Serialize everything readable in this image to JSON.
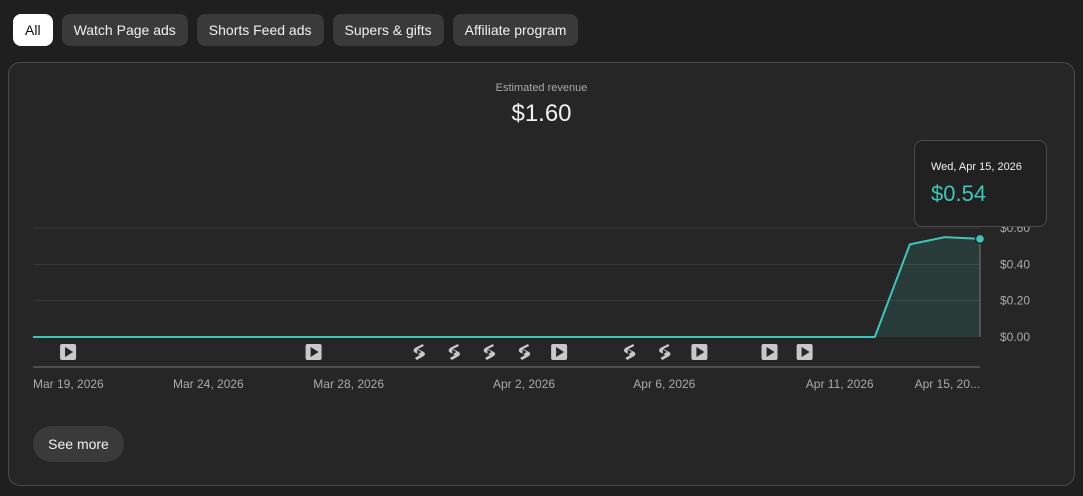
{
  "filters": [
    {
      "label": "All",
      "active": true
    },
    {
      "label": "Watch Page ads",
      "active": false
    },
    {
      "label": "Shorts Feed ads",
      "active": false
    },
    {
      "label": "Supers & gifts",
      "active": false
    },
    {
      "label": "Affiliate program",
      "active": false
    }
  ],
  "metric": {
    "label": "Estimated revenue",
    "value": "$1.60"
  },
  "tooltip": {
    "date": "Wed, Apr 15, 2026",
    "value": "$0.54"
  },
  "see_more_label": "See more",
  "colors": {
    "accent": "#3ec6b9",
    "background": "#1f1f1f",
    "card": "#262626"
  },
  "chart_data": {
    "type": "area",
    "title": "",
    "xlabel": "",
    "ylabel": "",
    "ylim": [
      0,
      0.6
    ],
    "y_ticks": [
      {
        "value": 0,
        "label": "$0.00"
      },
      {
        "value": 0.2,
        "label": "$0.20"
      },
      {
        "value": 0.4,
        "label": "$0.40"
      },
      {
        "value": 0.6,
        "label": "$0.60"
      }
    ],
    "x_start": "2026-03-19",
    "x_end": "2026-04-15",
    "x_ticks": [
      {
        "date": "2026-03-19",
        "label": "Mar 19, 2026"
      },
      {
        "date": "2026-03-24",
        "label": "Mar 24, 2026"
      },
      {
        "date": "2026-03-28",
        "label": "Mar 28, 2026"
      },
      {
        "date": "2026-04-02",
        "label": "Apr 2, 2026"
      },
      {
        "date": "2026-04-06",
        "label": "Apr 6, 2026"
      },
      {
        "date": "2026-04-11",
        "label": "Apr 11, 2026"
      },
      {
        "date": "2026-04-15",
        "label": "Apr 15, 20..."
      }
    ],
    "grid": true,
    "legend": "none",
    "series": [
      {
        "x": [
          "2026-03-19",
          "2026-03-20",
          "2026-03-21",
          "2026-03-22",
          "2026-03-23",
          "2026-03-24",
          "2026-03-25",
          "2026-03-26",
          "2026-03-27",
          "2026-03-28",
          "2026-03-29",
          "2026-03-30",
          "2026-03-31",
          "2026-04-01",
          "2026-04-02",
          "2026-04-03",
          "2026-04-04",
          "2026-04-05",
          "2026-04-06",
          "2026-04-07",
          "2026-04-08",
          "2026-04-09",
          "2026-04-10",
          "2026-04-11",
          "2026-04-12",
          "2026-04-13",
          "2026-04-14",
          "2026-04-15"
        ],
        "values": [
          0,
          0,
          0,
          0,
          0,
          0,
          0,
          0,
          0,
          0,
          0,
          0,
          0,
          0,
          0,
          0,
          0,
          0,
          0,
          0,
          0,
          0,
          0,
          0,
          0,
          0.51,
          0.55,
          0.54
        ]
      }
    ],
    "highlight": {
      "date": "2026-04-15",
      "value": 0.54
    },
    "upload_markers": [
      {
        "date": "2026-03-20",
        "kind": "video"
      },
      {
        "date": "2026-03-27",
        "kind": "video"
      },
      {
        "date": "2026-03-30",
        "kind": "short"
      },
      {
        "date": "2026-03-31",
        "kind": "short"
      },
      {
        "date": "2026-04-01",
        "kind": "short"
      },
      {
        "date": "2026-04-02",
        "kind": "short"
      },
      {
        "date": "2026-04-03",
        "kind": "video"
      },
      {
        "date": "2026-04-05",
        "kind": "short"
      },
      {
        "date": "2026-04-06",
        "kind": "short"
      },
      {
        "date": "2026-04-07",
        "kind": "video"
      },
      {
        "date": "2026-04-09",
        "kind": "video"
      },
      {
        "date": "2026-04-10",
        "kind": "video"
      }
    ]
  }
}
